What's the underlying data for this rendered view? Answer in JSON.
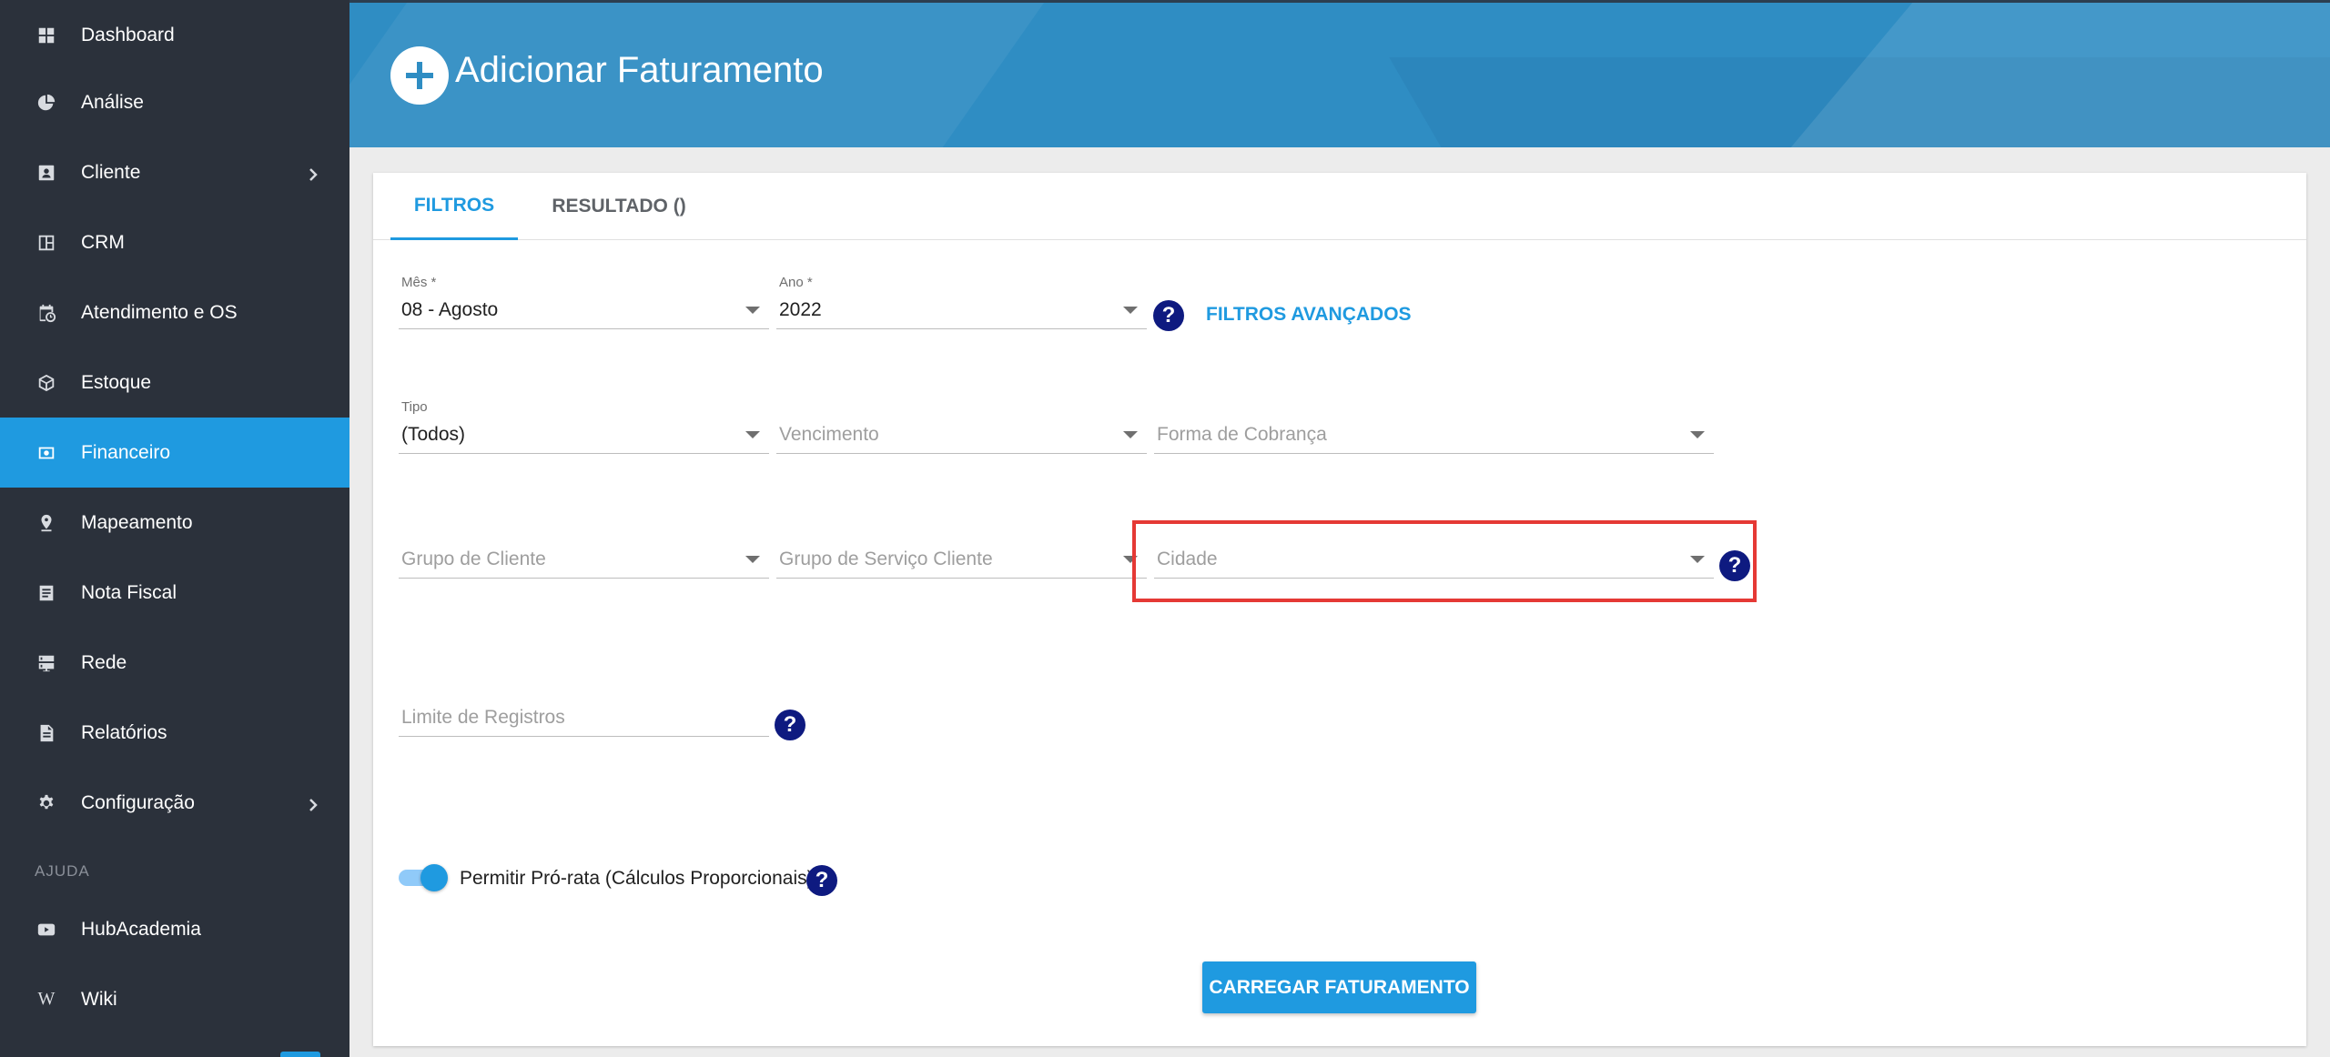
{
  "sidebar": {
    "items": [
      {
        "label": "Dashboard",
        "icon": "dashboard-icon"
      },
      {
        "label": "Análise",
        "icon": "pie-chart-icon"
      },
      {
        "label": "Cliente",
        "icon": "contact-card-icon",
        "has_submenu": true
      },
      {
        "label": "CRM",
        "icon": "crm-board-icon"
      },
      {
        "label": "Atendimento e OS",
        "icon": "calendar-clock-icon"
      },
      {
        "label": "Estoque",
        "icon": "box-icon"
      },
      {
        "label": "Financeiro",
        "icon": "money-icon",
        "active": true
      },
      {
        "label": "Mapeamento",
        "icon": "map-pin-icon"
      },
      {
        "label": "Nota Fiscal",
        "icon": "receipt-icon"
      },
      {
        "label": "Rede",
        "icon": "server-icon"
      },
      {
        "label": "Relatórios",
        "icon": "document-icon"
      },
      {
        "label": "Configuração",
        "icon": "gear-icon",
        "has_submenu": true
      }
    ],
    "section_help": "AJUDA",
    "help_items": [
      {
        "label": "HubAcademia",
        "icon": "youtube-icon"
      },
      {
        "label": "Wiki",
        "icon": "wikipedia-icon"
      }
    ],
    "active_color": "#1f9ae0",
    "background": "#2b313b"
  },
  "header": {
    "title": "Adicionar Faturamento",
    "icon": "add-circle-icon",
    "background": "#2f8dc3"
  },
  "tabs": [
    {
      "label": "FILTROS",
      "active": true
    },
    {
      "label": "RESULTADO ()",
      "active": false
    }
  ],
  "filters": {
    "mes": {
      "label": "Mês *",
      "value": "08 - Agosto"
    },
    "ano": {
      "label": "Ano *",
      "value": "2022"
    },
    "advanced_link": "FILTROS AVANÇADOS",
    "tipo": {
      "label": "Tipo",
      "value": "(Todos)"
    },
    "vencimento": {
      "placeholder": "Vencimento"
    },
    "forma_cobranca": {
      "placeholder": "Forma de Cobrança"
    },
    "grupo_cliente": {
      "placeholder": "Grupo de Cliente"
    },
    "grupo_servico": {
      "placeholder": "Grupo de Serviço Cliente"
    },
    "cidade": {
      "placeholder": "Cidade"
    },
    "limite": {
      "placeholder": "Limite de Registros"
    },
    "pro_rata": {
      "label": "Permitir Pró-rata (Cálculos Proporcionais)",
      "enabled": true
    }
  },
  "help_symbol": "?",
  "load_button": "CARREGAR FATURAMENTO",
  "highlight_color": "#e53935"
}
